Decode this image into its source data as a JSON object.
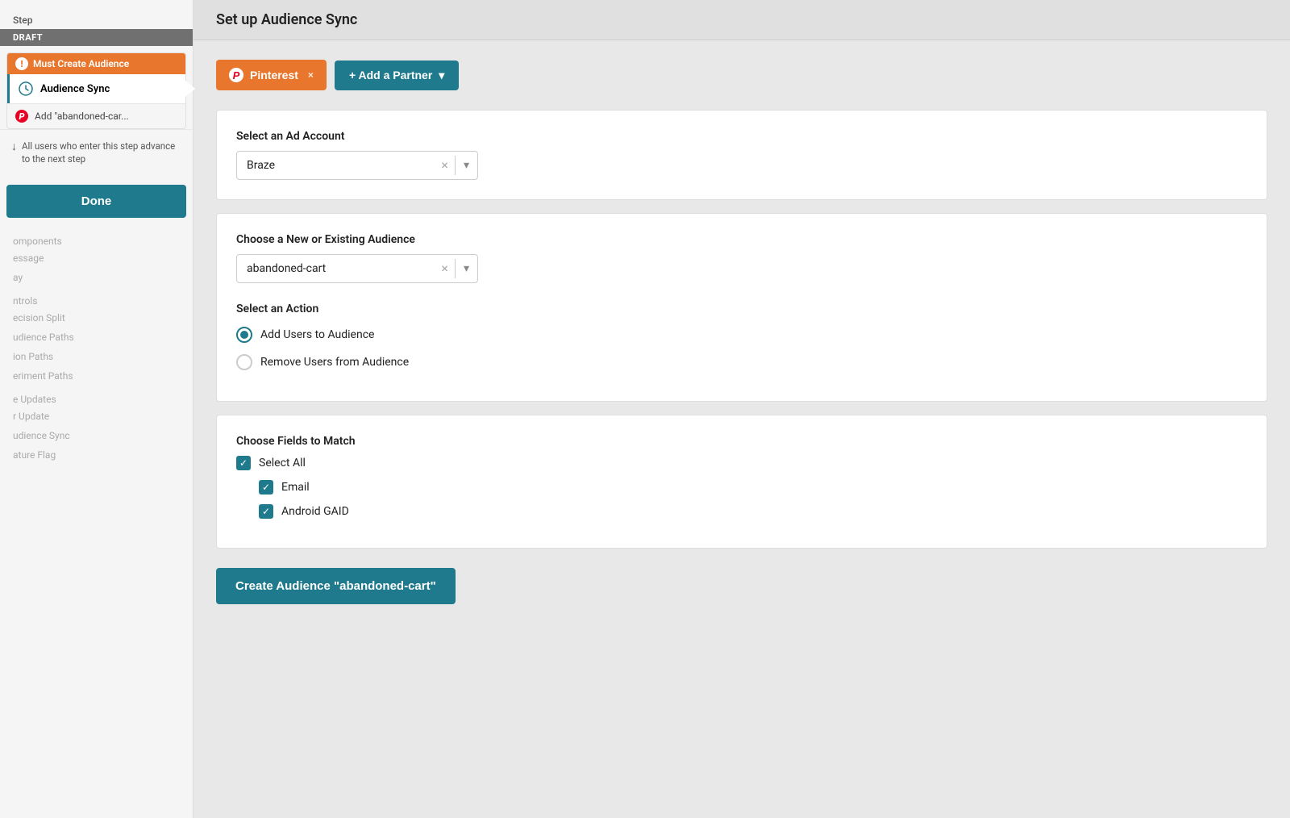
{
  "sidebar": {
    "step_label": "Step",
    "draft_badge": "DRAFT",
    "must_create_label": "Must Create Audience",
    "audience_sync_label": "Audience Sync",
    "add_item_label": "Add \"abandoned-car...",
    "advance_note": "All users who enter this step advance to the next step",
    "done_button": "Done",
    "sections": [
      {
        "label": "omponents"
      },
      {
        "label": "essage"
      },
      {
        "label": "ay"
      },
      {
        "label": "ntrols"
      },
      {
        "label": "ecision Split"
      },
      {
        "label": "udience Paths"
      },
      {
        "label": "ion Paths"
      },
      {
        "label": "eriment Paths"
      },
      {
        "label": "e Updates"
      },
      {
        "label": "r Update"
      },
      {
        "label": "udience Sync"
      },
      {
        "label": "ature Flag"
      }
    ]
  },
  "main": {
    "title": "Set up Audience Sync",
    "partner_button": "Pinterest",
    "partner_close": "×",
    "add_partner_button": "+ Add a Partner",
    "ad_account_label": "Select an Ad Account",
    "ad_account_value": "Braze",
    "audience_label": "Choose a New or Existing Audience",
    "audience_value": "abandoned-cart",
    "action_label": "Select an Action",
    "action_option1": "Add Users to Audience",
    "action_option2": "Remove Users from Audience",
    "fields_label": "Choose Fields to Match",
    "select_all_label": "Select All",
    "field_email": "Email",
    "field_android": "Android GAID",
    "create_button": "Create Audience \"abandoned-cart\""
  }
}
